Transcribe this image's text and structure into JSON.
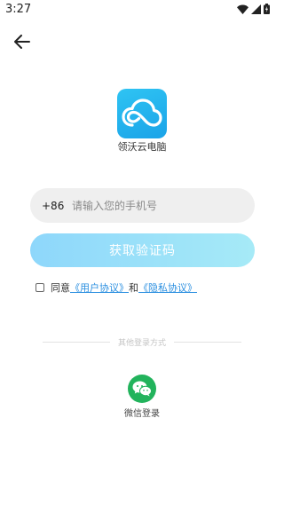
{
  "status_bar": {
    "time": "3:27"
  },
  "app": {
    "name": "领沃云电脑"
  },
  "phone": {
    "country_code": "+86",
    "placeholder": "请输入您的手机号"
  },
  "actions": {
    "get_code_label": "获取验证码"
  },
  "agreement": {
    "prefix": "同意",
    "user_agreement": "《用户协议》",
    "conjunction": "和",
    "privacy_agreement": "《隐私协议》"
  },
  "other_login": {
    "title": "其他登录方式",
    "wechat_label": "微信登录"
  },
  "icons": {
    "back": "arrow-left-icon",
    "logo": "cloud-icon",
    "wechat": "wechat-icon"
  },
  "colors": {
    "brand": "#1aa3e8",
    "button_start": "#8ed7fb",
    "button_end": "#a6eaf7",
    "link": "#2b8fe0",
    "wechat": "#22b35c"
  }
}
